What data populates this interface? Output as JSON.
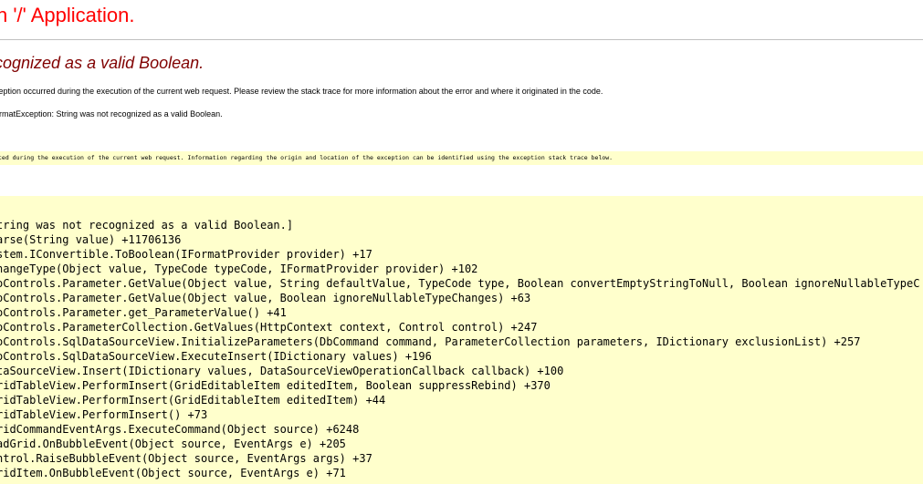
{
  "header": {
    "title": "n '/' Application."
  },
  "error": {
    "subtitle": "cognized as a valid Boolean.",
    "description_line": "ception occurred during the execution of the current web request. Please review the stack trace for more information about the error and where it originated in the code.",
    "exception_line": "ormatException: String was not recognized as a valid Boolean.",
    "source_note": "ted during the execution of the current web request. Information regarding the origin and location of the exception can be identified using the exception stack trace below."
  },
  "stack_trace": [
    "tring was not recognized as a valid Boolean.]",
    "arse(String value) +11706136",
    "stem.IConvertible.ToBoolean(IFormatProvider provider) +17",
    "hangeType(Object value, TypeCode typeCode, IFormatProvider provider) +102",
    "oControls.Parameter.GetValue(Object value, String defaultValue, TypeCode type, Boolean convertEmptyStringToNull, Boolean ignoreNullableTypeC",
    "oControls.Parameter.GetValue(Object value, Boolean ignoreNullableTypeChanges) +63",
    "oControls.Parameter.get_ParameterValue() +41",
    "oControls.ParameterCollection.GetValues(HttpContext context, Control control) +247",
    "oControls.SqlDataSourceView.InitializeParameters(DbCommand command, ParameterCollection parameters, IDictionary exclusionList) +257",
    "oControls.SqlDataSourceView.ExecuteInsert(IDictionary values) +196",
    "taSourceView.Insert(IDictionary values, DataSourceViewOperationCallback callback) +100",
    "ridTableView.PerformInsert(GridEditableItem editedItem, Boolean suppressRebind) +370",
    "ridTableView.PerformInsert(GridEditableItem editedItem) +44",
    "ridTableView.PerformInsert() +73",
    "ridCommandEventArgs.ExecuteCommand(Object source) +6248",
    "adGrid.OnBubbleEvent(Object source, EventArgs e) +205",
    "ntrol.RaiseBubbleEvent(Object source, EventArgs args) +37",
    "ridItem.OnBubbleEvent(Object source, EventArgs e) +71"
  ],
  "colors": {
    "title": "#ff0000",
    "subtitle": "#800000",
    "highlight_background": "#ffffcc"
  }
}
